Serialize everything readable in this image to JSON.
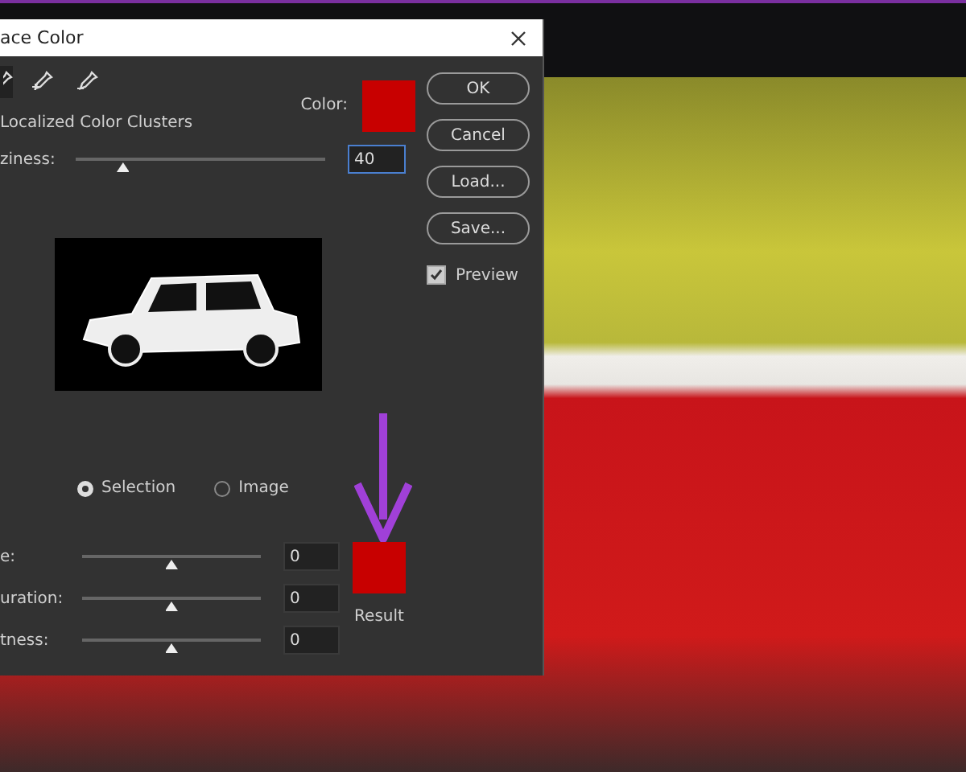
{
  "dialog": {
    "title": "ace Color",
    "localized_clusters": {
      "label": "Localized Color Clusters"
    },
    "color_label": "Color:",
    "fuzziness": {
      "label": "ziness:",
      "value": "40",
      "level": 0.19
    },
    "buttons": [
      "OK",
      "Cancel",
      "Load...",
      "Save..."
    ],
    "preview": {
      "label": "Preview",
      "checked": true
    },
    "view_options": [
      {
        "label": "Selection",
        "selected": true
      },
      {
        "label": "Image",
        "selected": false
      }
    ],
    "adjustments": [
      {
        "label": "e:",
        "value": "0",
        "level": 0.5
      },
      {
        "label": "uration:",
        "value": "0",
        "level": 0.5
      },
      {
        "label": "tness:",
        "value": "0",
        "level": 0.5
      }
    ],
    "result_label": "Result"
  }
}
